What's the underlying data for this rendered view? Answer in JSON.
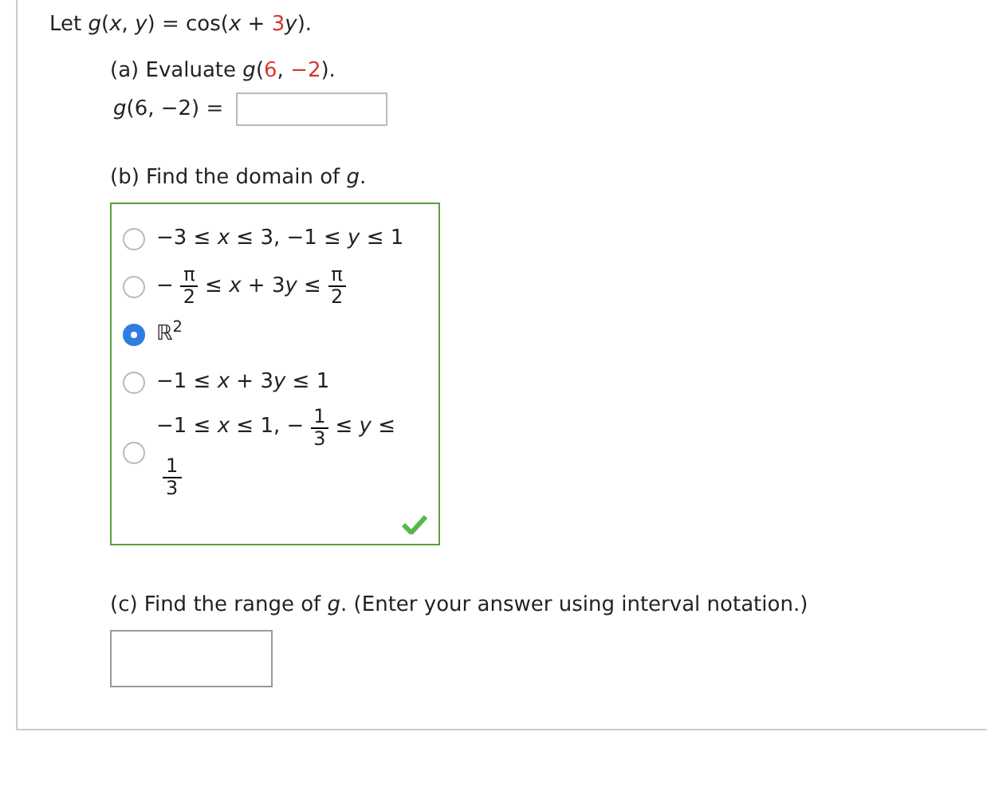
{
  "prompt": [
    {
      "kind": "plain",
      "text": "Let *g*(*x*, *y*) = cos(*x* + "
    },
    {
      "kind": "value",
      "text": "3"
    },
    {
      "kind": "plain",
      "text": "*y*)."
    }
  ],
  "part_a": {
    "label": [
      {
        "kind": "plain",
        "text": "(a) Evaluate  *g*("
      },
      {
        "kind": "value",
        "text": "6"
      },
      {
        "kind": "plain",
        "text": ", "
      },
      {
        "kind": "value",
        "text": "−2"
      },
      {
        "kind": "plain",
        "text": ")."
      }
    ],
    "answer_label": "*g*(6, −2) ="
  },
  "part_b": {
    "label": "(b) Find the domain of *g*.",
    "correct": true,
    "options": [
      {
        "selected": false,
        "parts": [
          {
            "kind": "text",
            "text": "−3 ≤ *x* ≤ 3, −1 ≤ *y* ≤ 1"
          }
        ]
      },
      {
        "selected": false,
        "parts": [
          {
            "kind": "text",
            "text": "−"
          },
          {
            "kind": "fraction",
            "numerator": "π",
            "denominator": "2"
          },
          {
            "kind": "text",
            "text": "≤ *x* + 3"
          },
          {
            "kind": "text",
            "text": "*y* ≤"
          },
          {
            "kind": "fraction",
            "numerator": "π",
            "denominator": "2"
          }
        ]
      },
      {
        "selected": true,
        "parts": [
          {
            "kind": "text",
            "text": "ℝ$^{2}$"
          }
        ]
      },
      {
        "selected": false,
        "parts": [
          {
            "kind": "text",
            "text": "−1 ≤ *x* + 3"
          },
          {
            "kind": "text",
            "text": "*y* ≤ 1"
          }
        ]
      },
      {
        "selected": false,
        "parts": [
          {
            "kind": "text",
            "text": "−1 ≤ *x* ≤ 1, −"
          },
          {
            "kind": "fraction",
            "numerator": "1",
            "denominator": "3"
          },
          {
            "kind": "text",
            "text": "≤ *y* ≤"
          },
          {
            "kind": "break"
          },
          {
            "kind": "fraction",
            "numerator": "1",
            "denominator": "3"
          }
        ]
      }
    ]
  },
  "part_c": {
    "label": "(c) Find the range of *g*. (Enter your answer using interval notation.)"
  }
}
